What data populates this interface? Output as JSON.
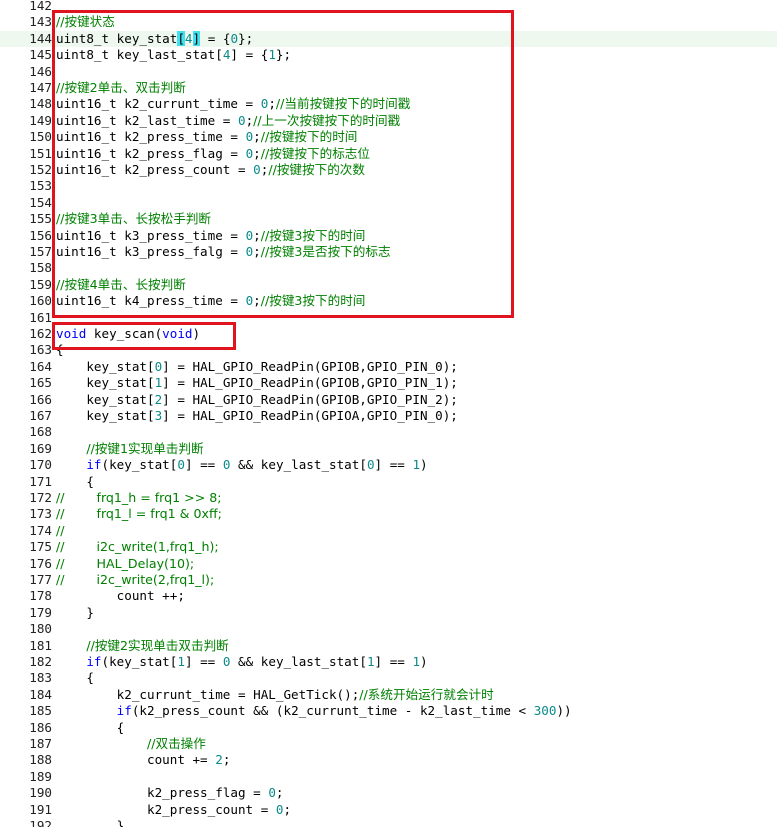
{
  "highlight_line": "144",
  "lines": [
    {
      "n": "142",
      "t": []
    },
    {
      "n": "143",
      "t": [
        {
          "c": "cm",
          "s": "//按键状态"
        }
      ]
    },
    {
      "n": "144",
      "t": [
        {
          "c": "",
          "s": "uint8_t key_stat"
        },
        {
          "c": "br",
          "s": "["
        },
        {
          "c": "num",
          "s": "4"
        },
        {
          "c": "br",
          "s": "]"
        },
        {
          "c": "",
          "s": " = {"
        },
        {
          "c": "num",
          "s": "0"
        },
        {
          "c": "",
          "s": "};"
        }
      ]
    },
    {
      "n": "145",
      "t": [
        {
          "c": "",
          "s": "uint8_t key_last_stat["
        },
        {
          "c": "num",
          "s": "4"
        },
        {
          "c": "",
          "s": "] = {"
        },
        {
          "c": "num",
          "s": "1"
        },
        {
          "c": "",
          "s": "};"
        }
      ]
    },
    {
      "n": "146",
      "t": []
    },
    {
      "n": "147",
      "t": [
        {
          "c": "cm",
          "s": "//按键2单击、双击判断"
        }
      ]
    },
    {
      "n": "148",
      "t": [
        {
          "c": "",
          "s": "uint16_t k2_currunt_time = "
        },
        {
          "c": "num",
          "s": "0"
        },
        {
          "c": "",
          "s": ";"
        },
        {
          "c": "cm",
          "s": "//当前按键按下的时间戳"
        }
      ]
    },
    {
      "n": "149",
      "t": [
        {
          "c": "",
          "s": "uint16_t k2_last_time = "
        },
        {
          "c": "num",
          "s": "0"
        },
        {
          "c": "",
          "s": ";"
        },
        {
          "c": "cm",
          "s": "//上一次按键按下的时间戳"
        }
      ]
    },
    {
      "n": "150",
      "t": [
        {
          "c": "",
          "s": "uint16_t k2_press_time = "
        },
        {
          "c": "num",
          "s": "0"
        },
        {
          "c": "",
          "s": ";"
        },
        {
          "c": "cm",
          "s": "//按键按下的时间"
        }
      ]
    },
    {
      "n": "151",
      "t": [
        {
          "c": "",
          "s": "uint16_t k2_press_flag = "
        },
        {
          "c": "num",
          "s": "0"
        },
        {
          "c": "",
          "s": ";"
        },
        {
          "c": "cm",
          "s": "//按键按下的标志位"
        }
      ]
    },
    {
      "n": "152",
      "t": [
        {
          "c": "",
          "s": "uint16_t k2_press_count = "
        },
        {
          "c": "num",
          "s": "0"
        },
        {
          "c": "",
          "s": ";"
        },
        {
          "c": "cm",
          "s": "//按键按下的次数"
        }
      ]
    },
    {
      "n": "153",
      "t": []
    },
    {
      "n": "154",
      "t": []
    },
    {
      "n": "155",
      "t": [
        {
          "c": "cm",
          "s": "//按键3单击、长按松手判断"
        }
      ]
    },
    {
      "n": "156",
      "t": [
        {
          "c": "",
          "s": "uint16_t k3_press_time = "
        },
        {
          "c": "num",
          "s": "0"
        },
        {
          "c": "",
          "s": ";"
        },
        {
          "c": "cm",
          "s": "//按键3按下的时间"
        }
      ]
    },
    {
      "n": "157",
      "t": [
        {
          "c": "",
          "s": "uint16_t k3_press_falg = "
        },
        {
          "c": "num",
          "s": "0"
        },
        {
          "c": "",
          "s": ";"
        },
        {
          "c": "cm",
          "s": "//按键3是否按下的标志"
        }
      ]
    },
    {
      "n": "158",
      "t": []
    },
    {
      "n": "159",
      "t": [
        {
          "c": "cm",
          "s": "//按键4单击、长按判断"
        }
      ]
    },
    {
      "n": "160",
      "t": [
        {
          "c": "",
          "s": "uint16_t k4_press_time = "
        },
        {
          "c": "num",
          "s": "0"
        },
        {
          "c": "",
          "s": ";"
        },
        {
          "c": "cm",
          "s": "//按键3按下的时间"
        }
      ]
    },
    {
      "n": "161",
      "t": []
    },
    {
      "n": "162",
      "t": [
        {
          "c": "kw",
          "s": "void"
        },
        {
          "c": "",
          "s": " key_scan("
        },
        {
          "c": "kw",
          "s": "void"
        },
        {
          "c": "",
          "s": ")"
        }
      ]
    },
    {
      "n": "163",
      "t": [
        {
          "c": "",
          "s": "{"
        }
      ]
    },
    {
      "n": "164",
      "t": [
        {
          "c": "",
          "s": "    key_stat["
        },
        {
          "c": "num",
          "s": "0"
        },
        {
          "c": "",
          "s": "] = HAL_GPIO_ReadPin(GPIOB,GPIO_PIN_0);"
        }
      ]
    },
    {
      "n": "165",
      "t": [
        {
          "c": "",
          "s": "    key_stat["
        },
        {
          "c": "num",
          "s": "1"
        },
        {
          "c": "",
          "s": "] = HAL_GPIO_ReadPin(GPIOB,GPIO_PIN_1);"
        }
      ]
    },
    {
      "n": "166",
      "t": [
        {
          "c": "",
          "s": "    key_stat["
        },
        {
          "c": "num",
          "s": "2"
        },
        {
          "c": "",
          "s": "] = HAL_GPIO_ReadPin(GPIOB,GPIO_PIN_2);"
        }
      ]
    },
    {
      "n": "167",
      "t": [
        {
          "c": "",
          "s": "    key_stat["
        },
        {
          "c": "num",
          "s": "3"
        },
        {
          "c": "",
          "s": "] = HAL_GPIO_ReadPin(GPIOA,GPIO_PIN_0);"
        }
      ]
    },
    {
      "n": "168",
      "t": []
    },
    {
      "n": "169",
      "t": [
        {
          "c": "",
          "s": "    "
        },
        {
          "c": "cm",
          "s": "//按键1实现单击判断"
        }
      ]
    },
    {
      "n": "170",
      "t": [
        {
          "c": "",
          "s": "    "
        },
        {
          "c": "kw",
          "s": "if"
        },
        {
          "c": "",
          "s": "(key_stat["
        },
        {
          "c": "num",
          "s": "0"
        },
        {
          "c": "",
          "s": "] == "
        },
        {
          "c": "num",
          "s": "0"
        },
        {
          "c": "",
          "s": " && key_last_stat["
        },
        {
          "c": "num",
          "s": "0"
        },
        {
          "c": "",
          "s": "] == "
        },
        {
          "c": "num",
          "s": "1"
        },
        {
          "c": "",
          "s": ")"
        }
      ]
    },
    {
      "n": "171",
      "t": [
        {
          "c": "",
          "s": "    {"
        }
      ]
    },
    {
      "n": "172",
      "t": [
        {
          "c": "cm",
          "s": "//        frq1_h = frq1 >> 8;"
        }
      ]
    },
    {
      "n": "173",
      "t": [
        {
          "c": "cm",
          "s": "//        frq1_l = frq1 & 0xff;"
        }
      ]
    },
    {
      "n": "174",
      "t": [
        {
          "c": "cm",
          "s": "//"
        }
      ]
    },
    {
      "n": "175",
      "t": [
        {
          "c": "cm",
          "s": "//        i2c_write(1,frq1_h);"
        }
      ]
    },
    {
      "n": "176",
      "t": [
        {
          "c": "cm",
          "s": "//        HAL_Delay(10);"
        }
      ]
    },
    {
      "n": "177",
      "t": [
        {
          "c": "cm",
          "s": "//        i2c_write(2,frq1_l);"
        }
      ]
    },
    {
      "n": "178",
      "t": [
        {
          "c": "",
          "s": "        count ++;"
        }
      ]
    },
    {
      "n": "179",
      "t": [
        {
          "c": "",
          "s": "    }"
        }
      ]
    },
    {
      "n": "180",
      "t": []
    },
    {
      "n": "181",
      "t": [
        {
          "c": "",
          "s": "    "
        },
        {
          "c": "cm",
          "s": "//按键2实现单击双击判断"
        }
      ]
    },
    {
      "n": "182",
      "t": [
        {
          "c": "",
          "s": "    "
        },
        {
          "c": "kw",
          "s": "if"
        },
        {
          "c": "",
          "s": "(key_stat["
        },
        {
          "c": "num",
          "s": "1"
        },
        {
          "c": "",
          "s": "] == "
        },
        {
          "c": "num",
          "s": "0"
        },
        {
          "c": "",
          "s": " && key_last_stat["
        },
        {
          "c": "num",
          "s": "1"
        },
        {
          "c": "",
          "s": "] == "
        },
        {
          "c": "num",
          "s": "1"
        },
        {
          "c": "",
          "s": ")"
        }
      ]
    },
    {
      "n": "183",
      "t": [
        {
          "c": "",
          "s": "    {"
        }
      ]
    },
    {
      "n": "184",
      "t": [
        {
          "c": "",
          "s": "        k2_currunt_time = HAL_GetTick();"
        },
        {
          "c": "cm",
          "s": "//系统开始运行就会计时"
        }
      ]
    },
    {
      "n": "185",
      "t": [
        {
          "c": "",
          "s": "        "
        },
        {
          "c": "kw",
          "s": "if"
        },
        {
          "c": "",
          "s": "(k2_press_count && (k2_currunt_time - k2_last_time < "
        },
        {
          "c": "num",
          "s": "300"
        },
        {
          "c": "",
          "s": "))"
        }
      ]
    },
    {
      "n": "186",
      "t": [
        {
          "c": "",
          "s": "        {"
        }
      ]
    },
    {
      "n": "187",
      "t": [
        {
          "c": "",
          "s": "            "
        },
        {
          "c": "cm",
          "s": "//双击操作"
        }
      ]
    },
    {
      "n": "188",
      "t": [
        {
          "c": "",
          "s": "            count += "
        },
        {
          "c": "num",
          "s": "2"
        },
        {
          "c": "",
          "s": ";"
        }
      ]
    },
    {
      "n": "189",
      "t": []
    },
    {
      "n": "190",
      "t": [
        {
          "c": "",
          "s": "            k2_press_flag = "
        },
        {
          "c": "num",
          "s": "0"
        },
        {
          "c": "",
          "s": ";"
        }
      ]
    },
    {
      "n": "191",
      "t": [
        {
          "c": "",
          "s": "            k2_press_count = "
        },
        {
          "c": "num",
          "s": "0"
        },
        {
          "c": "",
          "s": ";"
        }
      ]
    },
    {
      "n": "192",
      "t": [
        {
          "c": "",
          "s": "        }"
        }
      ]
    }
  ]
}
